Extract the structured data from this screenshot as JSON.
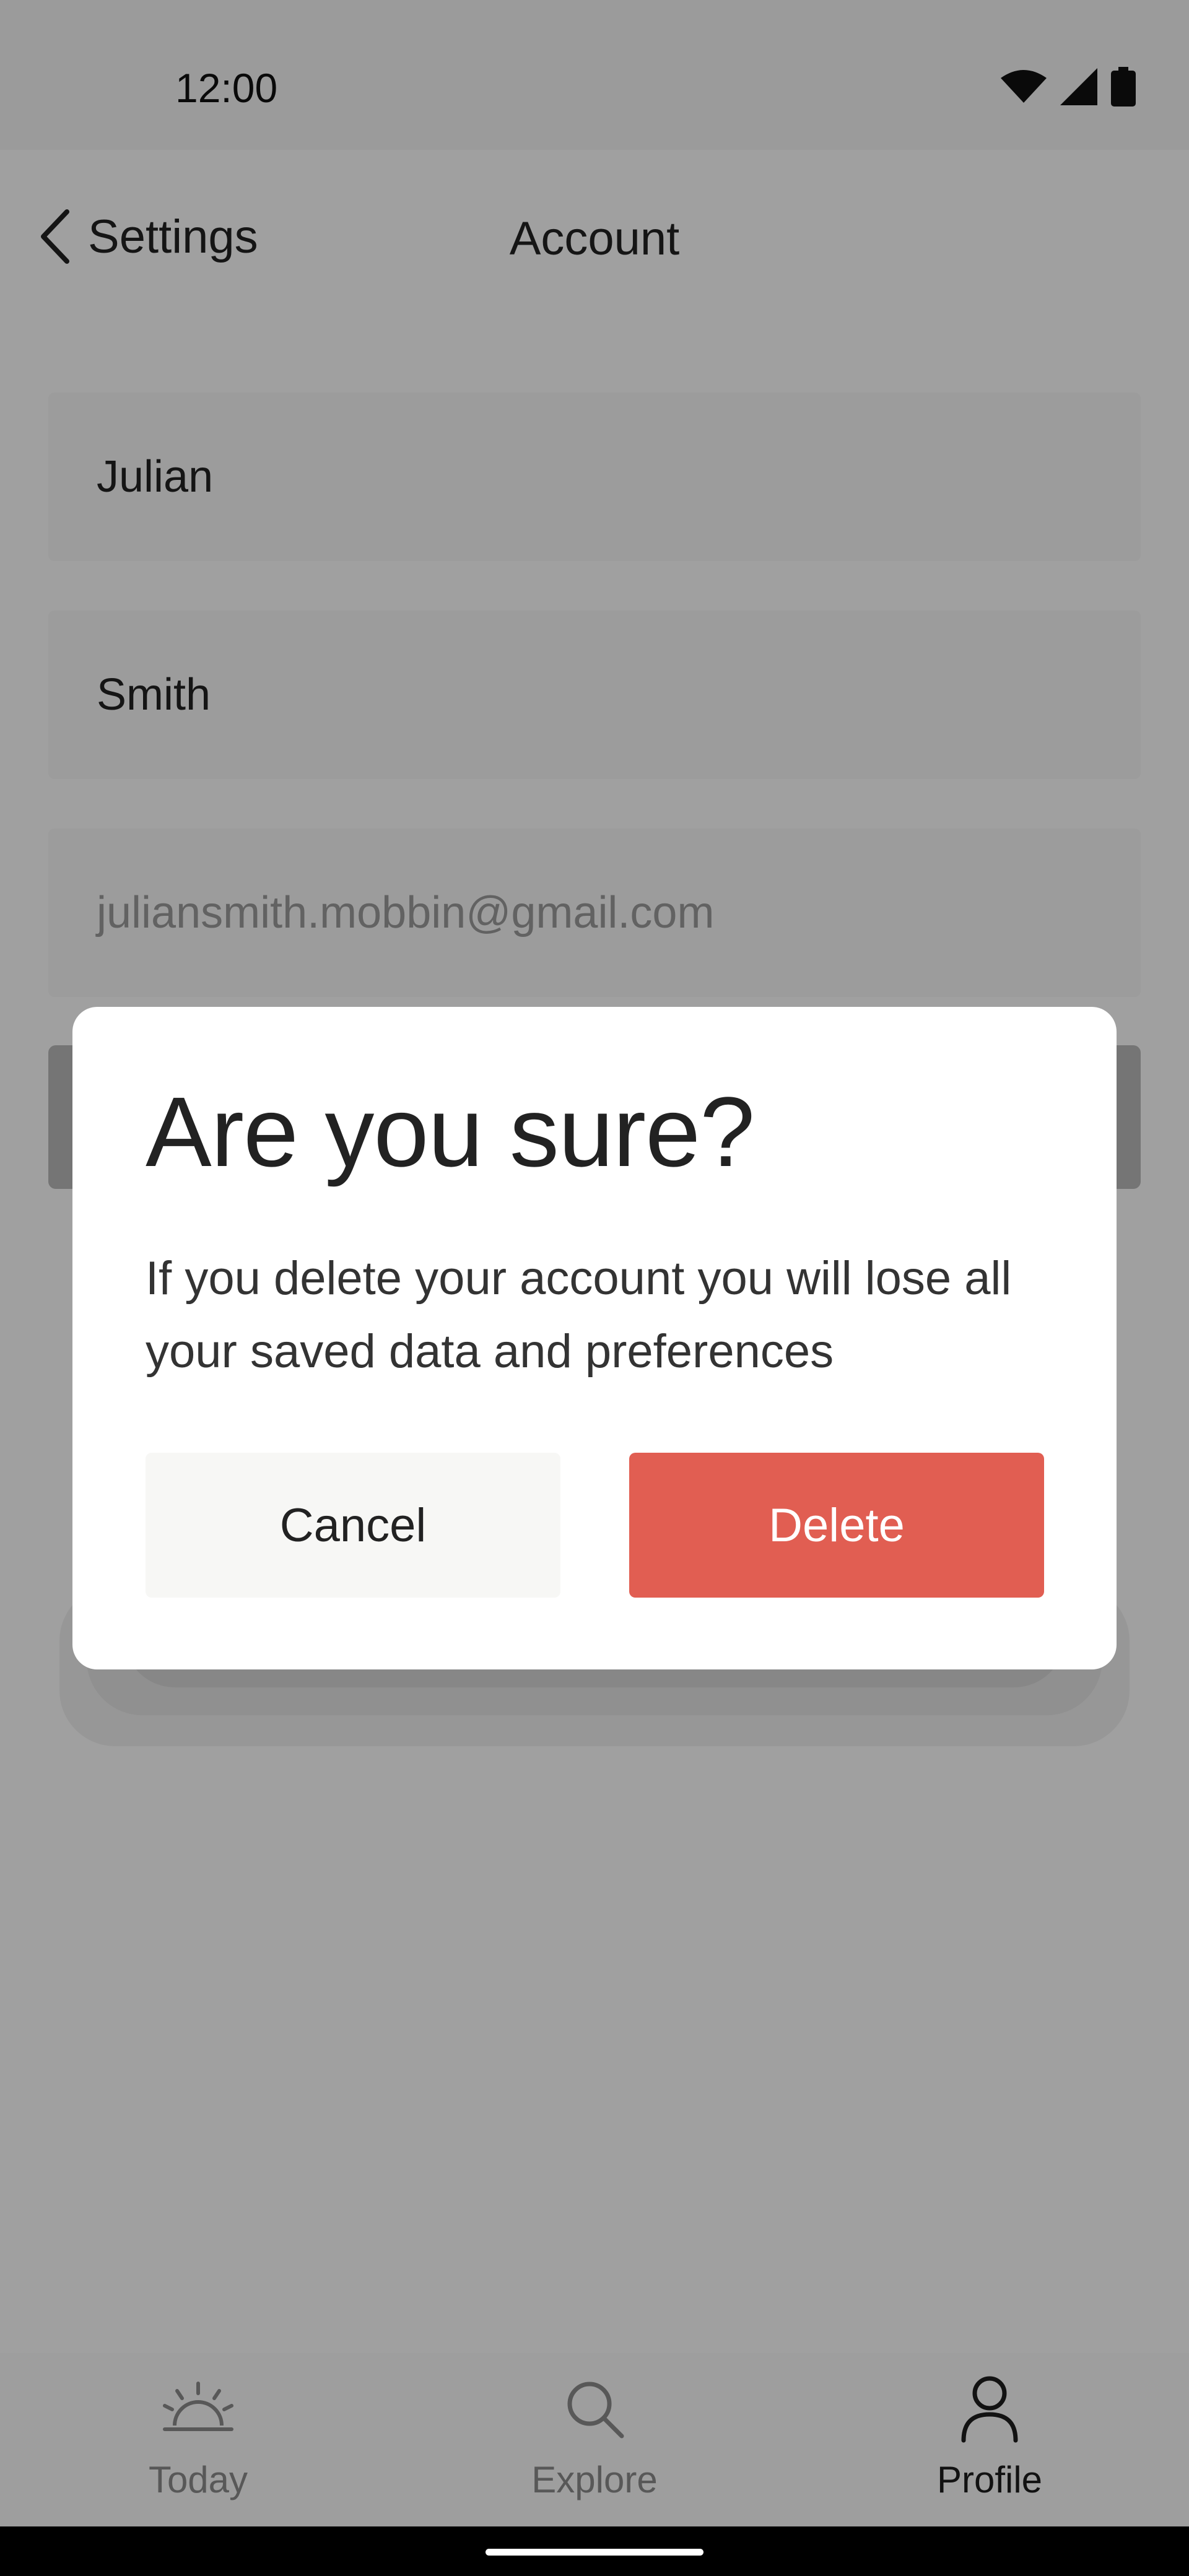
{
  "status_bar": {
    "time": "12:00",
    "icons": [
      "wifi-icon",
      "cellular-signal-icon",
      "battery-icon"
    ]
  },
  "header": {
    "back_label": "Settings",
    "title": "Account"
  },
  "fields": {
    "first_name": "Julian",
    "last_name": "Smith",
    "email": "juliansmith.mobbin@gmail.com"
  },
  "dialog": {
    "title": "Are you sure?",
    "message": "If you delete your account you will lose all your saved data and preferences",
    "cancel_label": "Cancel",
    "delete_label": "Delete"
  },
  "bottom_nav": {
    "items": [
      {
        "label": "Today",
        "icon": "sunrise-icon",
        "active": false
      },
      {
        "label": "Explore",
        "icon": "search-icon",
        "active": false
      },
      {
        "label": "Profile",
        "icon": "person-icon",
        "active": true
      }
    ]
  },
  "colors": {
    "danger": "#e15e52",
    "cancel_bg": "#f7f7f5",
    "scrim": "rgba(0,0,0,0.36)"
  }
}
